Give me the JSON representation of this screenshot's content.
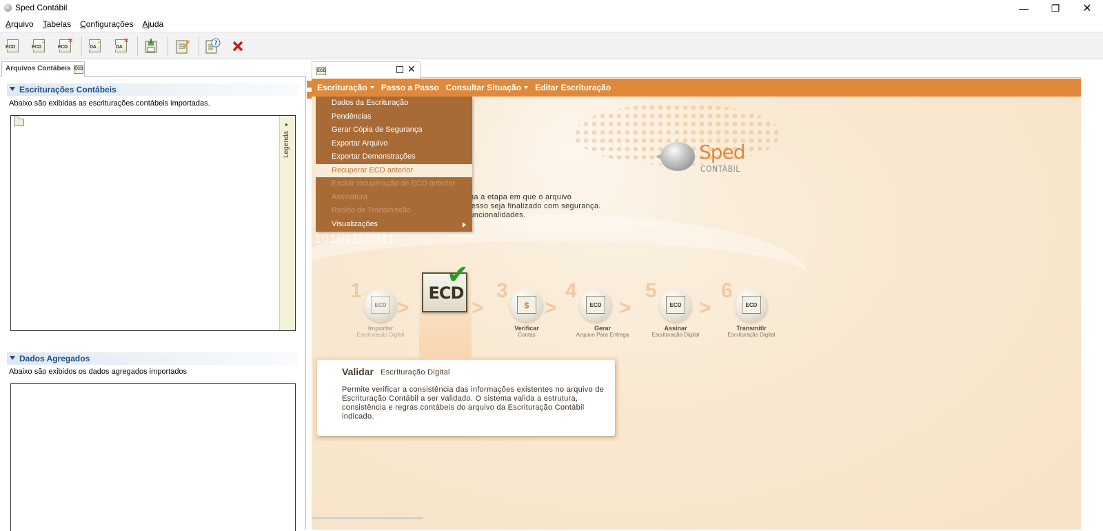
{
  "window": {
    "title": "Sped Contábil",
    "minimize": "—",
    "maximize": "❐",
    "close": "✕"
  },
  "menubar": {
    "items": [
      {
        "first": "A",
        "rest": "rquivo"
      },
      {
        "first": "T",
        "rest": "abelas"
      },
      {
        "first": "C",
        "rest": "onfigurações"
      },
      {
        "first": "A",
        "rest": "juda"
      }
    ]
  },
  "toolbar": {
    "buttons": [
      {
        "name": "ecd-open-icon",
        "label": "ECD",
        "mark": ""
      },
      {
        "name": "ecd-import-icon",
        "label": "ECD",
        "mark": "green"
      },
      {
        "name": "ecd-delete-icon",
        "label": "ECD",
        "mark": "red"
      },
      {
        "name": "da-import-icon",
        "label": "DA",
        "mark": "green"
      },
      {
        "name": "da-delete-icon",
        "label": "DA",
        "mark": "red"
      },
      {
        "name": "save-icon",
        "label": "",
        "mark": ""
      },
      {
        "name": "edit-icon",
        "label": "",
        "mark": ""
      },
      {
        "name": "help-icon",
        "label": "",
        "mark": ""
      },
      {
        "name": "exit-icon",
        "label": "",
        "mark": ""
      }
    ]
  },
  "left_panel": {
    "tab_label": "Arquivos Contábeis",
    "tab_icon_label": "ECD",
    "section1": {
      "title": "Escriturações Contábeis",
      "subtitle": "Abaixo são exibidas as escriturações contábeis importadas."
    },
    "legend_label": "Legenda",
    "section2": {
      "title": "Dados Agregados",
      "subtitle": "Abaixo são exibidos os dados agregados importados"
    }
  },
  "doc_tab": {
    "icon_label": "ECD",
    "close": "✕"
  },
  "orange_menu": [
    {
      "label": "Escrituração",
      "has_caret": true
    },
    {
      "label": "Passo a Passo",
      "has_caret": false
    },
    {
      "label": "Consultar Situação",
      "has_caret": true
    },
    {
      "label": "Editar Escrituração",
      "has_caret": false
    }
  ],
  "dropdown": [
    {
      "label": "Dados da Escrituração",
      "state": "enabled"
    },
    {
      "label": "Pendências",
      "state": "enabled"
    },
    {
      "label": "Gerar Cópia de Segurança",
      "state": "enabled"
    },
    {
      "label": "Exportar Arquivo",
      "state": "enabled"
    },
    {
      "label": "Exportar Demonstrações",
      "state": "enabled"
    },
    {
      "label": "Recuperar ECD anterior",
      "state": "highlight"
    },
    {
      "label": "Excluir recuperação de ECD anterior",
      "state": "disabled"
    },
    {
      "label": "Assinatura",
      "state": "disabled"
    },
    {
      "label": "Recibo de Transmissão",
      "state": "disabled"
    },
    {
      "label": "Visualizações",
      "state": "submenu"
    }
  ],
  "logo": {
    "sped": "Sped",
    "contabil": "CONTÁBIL"
  },
  "intro_lines": [
    "ma a etapa em que o arquivo",
    "cesso seja finalizado com segurança.",
    " funcionalidades."
  ],
  "faint_digits": "10101110011",
  "active_step": {
    "label": "ECD"
  },
  "steps": [
    {
      "num": "1",
      "title": "Importar",
      "subtitle": "Escrituração Digital",
      "icon": "ECD",
      "dim": true
    },
    {
      "num": "3",
      "title": "Verificar",
      "subtitle": "Contas",
      "icon": "$",
      "dim": false
    },
    {
      "num": "4",
      "title": "Gerar",
      "subtitle": "Arquivo Para Entrega",
      "icon": "ECD",
      "dim": false
    },
    {
      "num": "5",
      "title": "Assinar",
      "subtitle": "Escrituração Digital",
      "icon": "ECD",
      "dim": false
    },
    {
      "num": "6",
      "title": "Transmitir",
      "subtitle": "Escrituração Digital",
      "icon": "ECD",
      "dim": false
    }
  ],
  "info_card": {
    "title": "Validar",
    "subtitle": "Escrituração Digital",
    "body": "Permite verificar a consistência das informações existentes no arquivo de Escrituração Contábil a ser validado. O sistema valida a estrutura, consistência e regras contábeis do arquivo da Escrituração Contábil indicado."
  },
  "colors": {
    "accent": "#e0893a",
    "dropdown_bg": "#a86b36",
    "section_title": "#1d4f86"
  }
}
